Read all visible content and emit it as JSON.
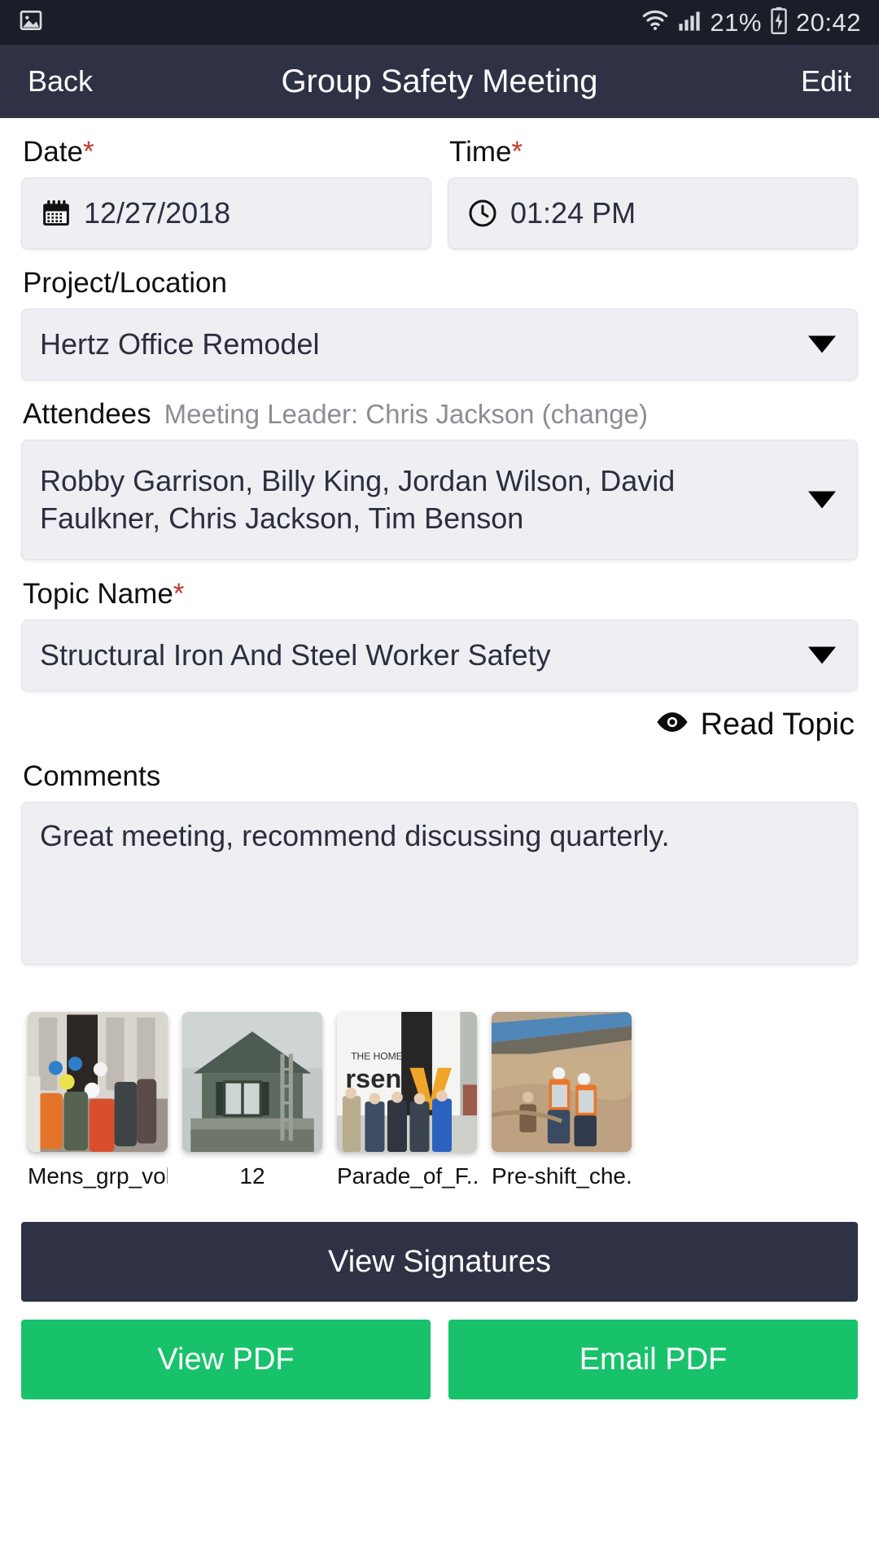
{
  "statusbar": {
    "time": "20:42",
    "battery_percent": "21%",
    "icons": [
      "image-icon",
      "wifi-icon",
      "signal-icon",
      "battery-charging-icon"
    ]
  },
  "appbar": {
    "back_label": "Back",
    "title": "Group Safety Meeting",
    "edit_label": "Edit",
    "background": "#2f3245"
  },
  "form": {
    "date": {
      "label": "Date",
      "required": "*",
      "value": "12/27/2018",
      "icon": "calendar-icon"
    },
    "time": {
      "label": "Time",
      "required": "*",
      "value": "01:24 PM",
      "icon": "clock-icon"
    },
    "project": {
      "label": "Project/Location",
      "value": "Hertz Office Remodel"
    },
    "attendees": {
      "label": "Attendees",
      "leader_note": "Meeting Leader: Chris Jackson (change)",
      "value": "Robby Garrison, Billy King, Jordan Wilson, David Faulkner, Chris Jackson, Tim Benson"
    },
    "topic": {
      "label": "Topic Name",
      "required": "*",
      "value": "Structural Iron And Steel Worker Safety",
      "read_label": "Read Topic",
      "read_icon": "eye-icon"
    },
    "comments": {
      "label": "Comments",
      "value": "Great meeting, recommend discussing quarterly."
    }
  },
  "attachments": [
    {
      "caption": "Mens_grp_vol",
      "alt": "group-of-workers-photo"
    },
    {
      "caption": "12",
      "alt": "house-exterior-photo"
    },
    {
      "caption": "Parade_of_F...",
      "alt": "men-in-front-of-trailer-photo"
    },
    {
      "caption": "Pre-shift_che...",
      "alt": "workers-on-dirt-slope-photo"
    }
  ],
  "actions": {
    "view_signatures": "View Signatures",
    "view_pdf": "View PDF",
    "email_pdf": "Email PDF",
    "green": "#17c26b"
  }
}
